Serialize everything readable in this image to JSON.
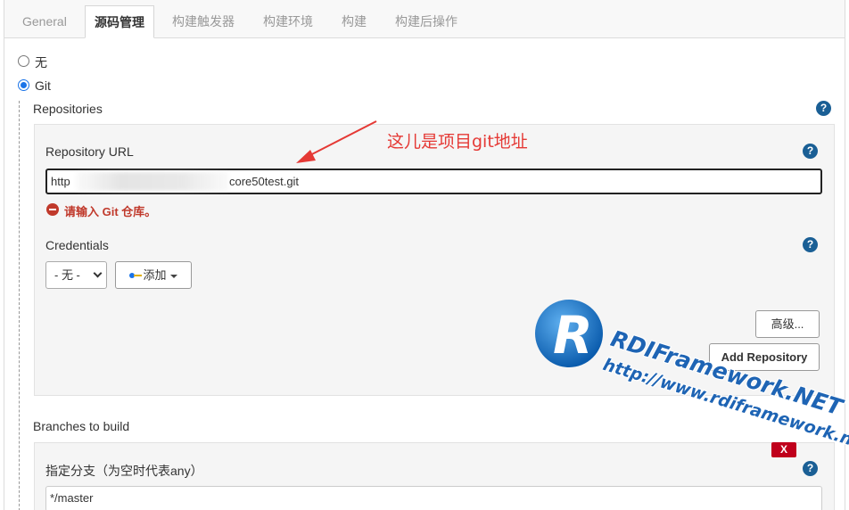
{
  "tabs": [
    {
      "label": "General"
    },
    {
      "label": "源码管理"
    },
    {
      "label": "构建触发器"
    },
    {
      "label": "构建环境"
    },
    {
      "label": "构建"
    },
    {
      "label": "构建后操作"
    }
  ],
  "scm": {
    "option_none": "无",
    "option_git": "Git"
  },
  "repositories": {
    "title": "Repositories",
    "url_label": "Repository URL",
    "url_value_prefix": "http",
    "url_value_suffix": "core50test.git",
    "error_text": "请输入 Git 仓库。",
    "credentials_label": "Credentials",
    "credentials_selected": "- 无 -",
    "add_button": "添加",
    "advanced_button": "高级...",
    "add_repository_button": "Add Repository"
  },
  "annotation": {
    "text": "这儿是项目git地址",
    "color": "#e53935"
  },
  "branches": {
    "title": "Branches to build",
    "specifier_label": "指定分支（为空时代表any）",
    "specifier_value": "*/master",
    "delete_label": "X"
  },
  "help_label": "?",
  "watermark": {
    "logo_letter": "R",
    "name": "RDIFramework.NET",
    "url": "http://www.rdiframework.net"
  },
  "colors": {
    "accent": "#1a73e8",
    "help": "#1a5f95",
    "error": "#c0392b",
    "watermark": "#1e64b4"
  }
}
